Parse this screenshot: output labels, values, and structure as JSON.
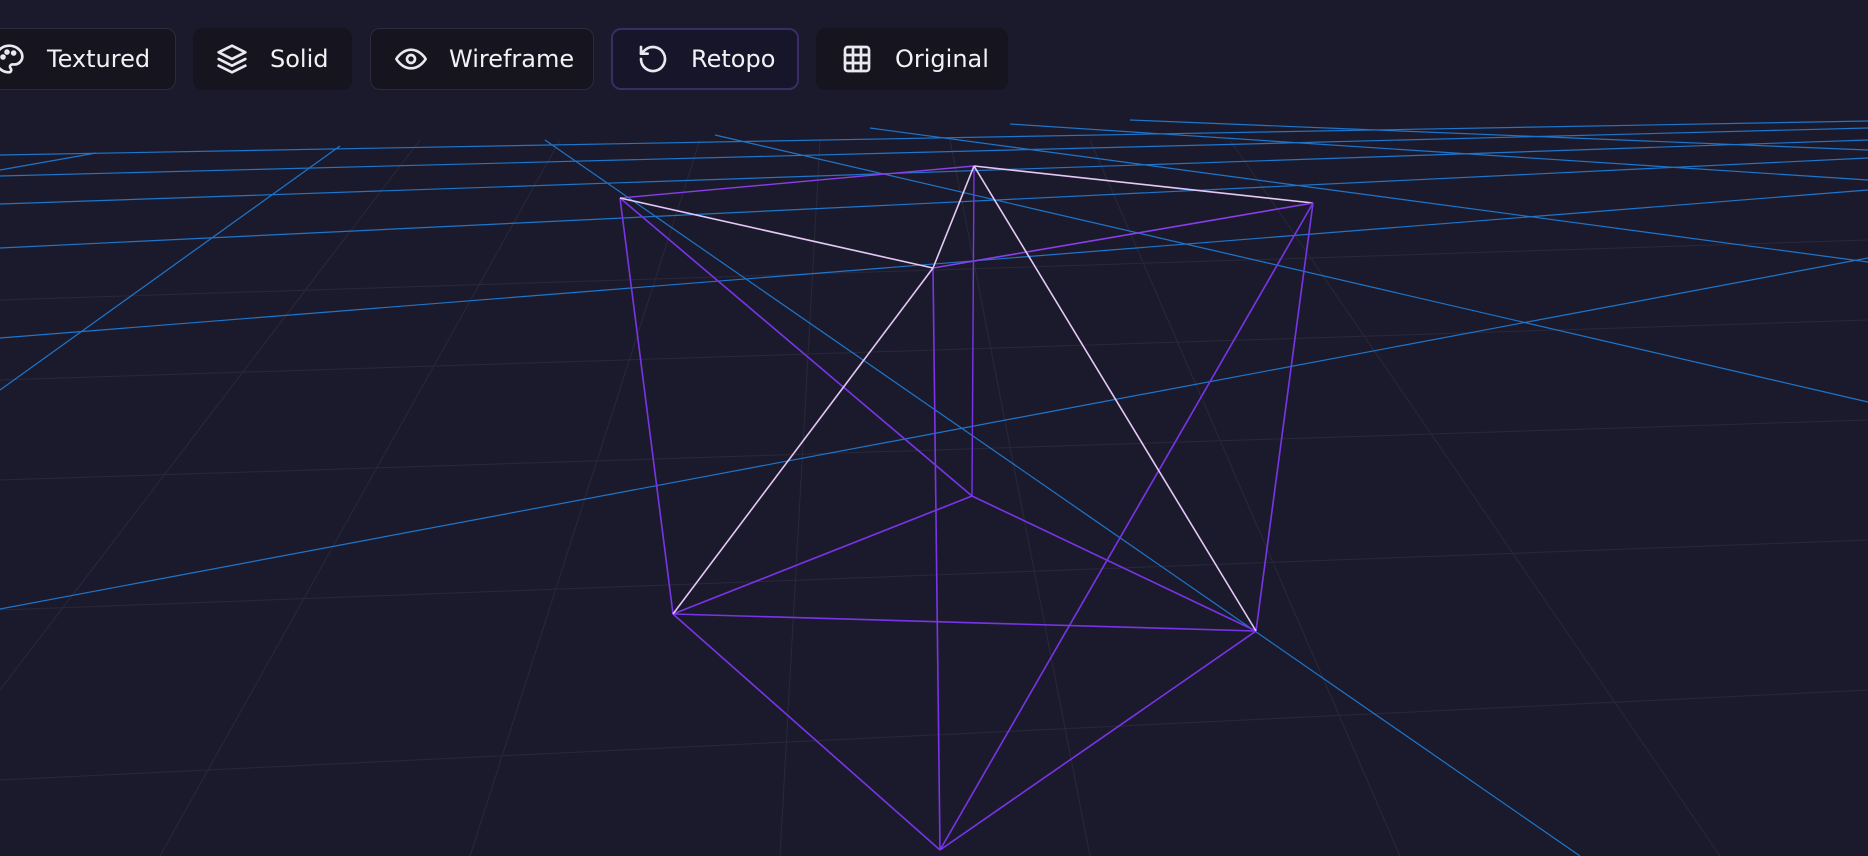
{
  "toolbar": {
    "buttons": [
      {
        "id": "textured",
        "label": "Textured",
        "icon": "palette-icon",
        "active": false
      },
      {
        "id": "solid",
        "label": "Solid",
        "icon": "layers-icon",
        "active": false
      },
      {
        "id": "wireframe",
        "label": "Wireframe",
        "icon": "eye-icon",
        "active": false
      },
      {
        "id": "retopo",
        "label": "Retopo",
        "icon": "rotate-ccw-icon",
        "active": true
      },
      {
        "id": "original",
        "label": "Original",
        "icon": "grid-icon",
        "active": false
      }
    ]
  },
  "colors": {
    "background": "#1b1a2c",
    "button_bg": "#15141f",
    "grid_primary": "#1f86e6",
    "grid_secondary": "#2a2a3a",
    "wire_edge": "#7a34e8",
    "wire_edge_light": "#e6c8f6"
  }
}
